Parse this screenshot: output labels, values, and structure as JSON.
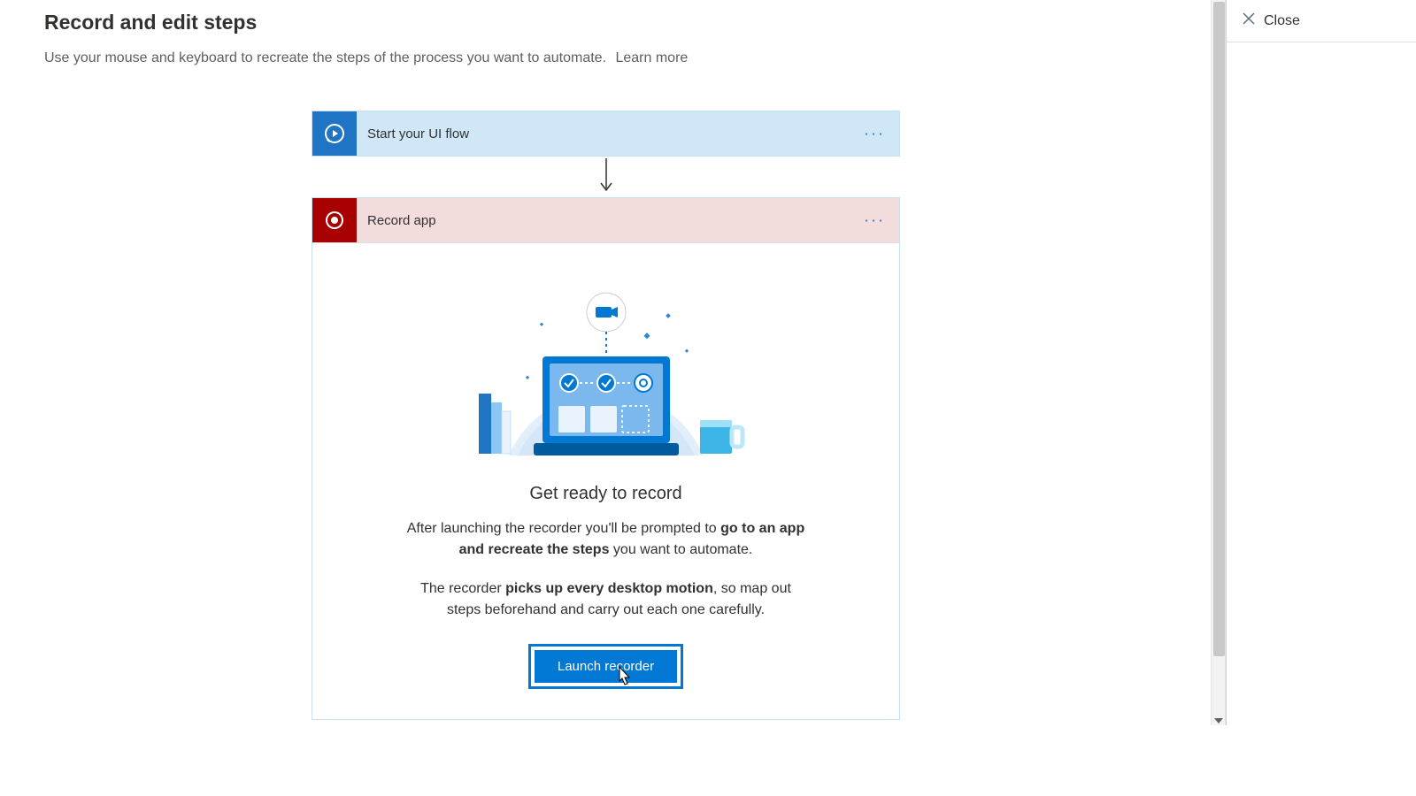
{
  "header": {
    "title": "Record and edit steps",
    "subtitle": "Use your mouse and keyboard to recreate the steps of the process you want to automate.",
    "learn_more": "Learn more"
  },
  "flow": {
    "start_card": {
      "title": "Start your UI flow"
    },
    "record_card": {
      "title": "Record app"
    }
  },
  "record_panel": {
    "heading": "Get ready to record",
    "p1_a": "After launching the recorder you'll be prompted to ",
    "p1_b": "go to an app and recreate the steps",
    "p1_c": " you want to automate.",
    "p2_a": "The recorder ",
    "p2_b": "picks up every desktop motion",
    "p2_c": ", so map out steps beforehand and carry out each one carefully.",
    "launch_label": "Launch recorder"
  },
  "right": {
    "close_label": "Close"
  },
  "icons": {
    "ellipsis": "···"
  }
}
